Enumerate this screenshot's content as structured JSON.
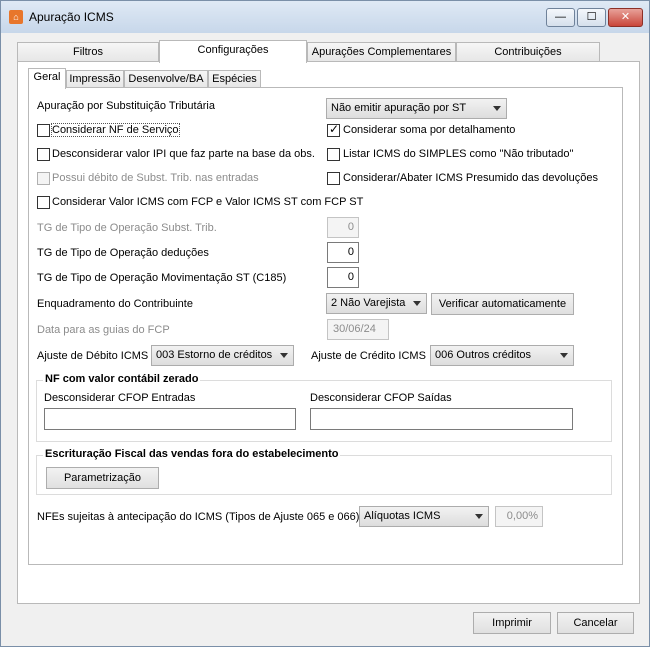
{
  "window": {
    "title": "Apuração ICMS"
  },
  "tabs": [
    "Filtros",
    "Configurações",
    "Apurações Complementares",
    "Contribuições"
  ],
  "subtabs": [
    "Geral",
    "Impressão",
    "Desenvolve/BA",
    "Espécies"
  ],
  "st": {
    "label": "Apuração por Substituição Tributária",
    "value": "Não emitir apuração por ST"
  },
  "checks": {
    "servico": "Considerar NF de Serviço",
    "soma_detalhamento": "Considerar soma por detalhamento",
    "desconsiderar_ipi": "Desconsiderar valor IPI que faz parte na base da obs.",
    "simples": "Listar ICMS do SIMPLES como \"Não tributado\"",
    "debito_subst": "Possui débito de Subst. Trib. nas entradas",
    "presumido": "Considerar/Abater ICMS Presumido das devoluções",
    "fcp": "Considerar Valor ICMS com FCP e Valor ICMS ST com FCP ST"
  },
  "tg": {
    "subst_label": "TG de Tipo de Operação Subst. Trib.",
    "subst_value": "0",
    "deducoes_label": "TG de Tipo de Operação deduções",
    "deducoes_value": "0",
    "mov_label": "TG de Tipo de Operação Movimentação ST (C185)",
    "mov_value": "0"
  },
  "enquadramento": {
    "label": "Enquadramento do Contribuinte",
    "value": "2 Não Varejista",
    "button": "Verificar automaticamente"
  },
  "fcp_data": {
    "label": "Data para as guias do FCP",
    "value": "30/06/24"
  },
  "ajustes": {
    "debito_label": "Ajuste de Débito ICMS",
    "debito_value": "003 Estorno de créditos",
    "credito_label": "Ajuste de Crédito ICMS",
    "credito_value": "006 Outros créditos"
  },
  "nf_zerado": {
    "title": "NF com valor contábil zerado",
    "entradas_label": "Desconsiderar CFOP Entradas",
    "saidas_label": "Desconsiderar CFOP Saídas"
  },
  "escrituracao": {
    "title": "Escrituração Fiscal das vendas fora do estabelecimento",
    "button": "Parametrização"
  },
  "nfes": {
    "label": "NFEs sujeitas à antecipação do ICMS (Tipos de Ajuste 065 e 066)",
    "select": "Alíquotas ICMS",
    "value": "0,00%"
  },
  "footer": {
    "print": "Imprimir",
    "cancel": "Cancelar"
  }
}
